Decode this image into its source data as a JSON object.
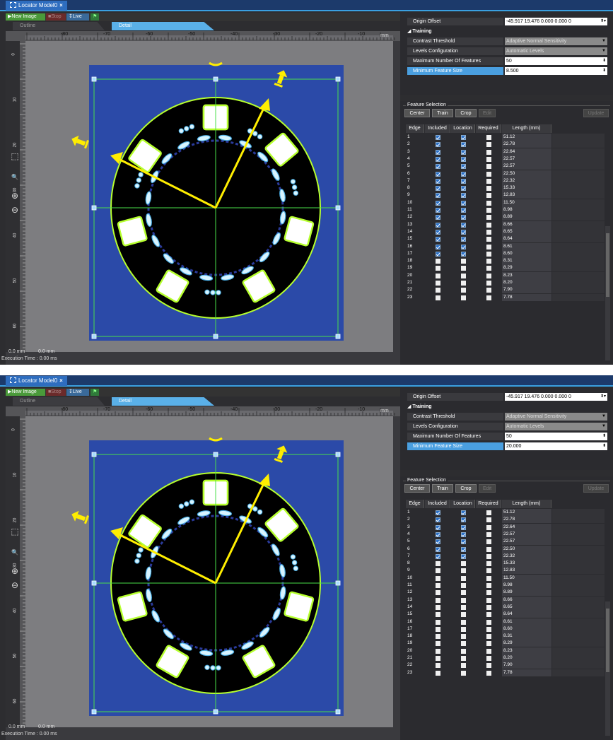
{
  "panels": [
    {
      "tab_title": "Locator Model0",
      "toolbar": {
        "new_image": "New Image",
        "stop": "Stop",
        "live": "Live"
      },
      "view_tabs": {
        "outline": "Outline",
        "detail": "Detail"
      },
      "ruler": {
        "unit": "mm",
        "top_labels": [
          "-80",
          "-70",
          "-60",
          "-50",
          "-40",
          "-30",
          "-20",
          "-10"
        ],
        "left_labels": [
          "0",
          "10",
          "20",
          "30",
          "40",
          "50",
          "60"
        ]
      },
      "status": {
        "x": "0.0 mm",
        "y": "0.0 mm",
        "execution": "Execution Time : 0.00 ms"
      },
      "properties": {
        "origin_offset": {
          "label": "Origin Offset",
          "value": "-45.917 19.476 0.000 0.000 0"
        },
        "training_header": "Training",
        "contrast_threshold": {
          "label": "Contrast Threshold",
          "value": "Adaptive Normal Sensitivity"
        },
        "levels_configuration": {
          "label": "Levels Configuration",
          "value": "Automatic Levels"
        },
        "max_features": {
          "label": "Maximum Number Of Features",
          "value": "50"
        },
        "min_feature_size": {
          "label": "Minimum Feature Size",
          "value": "8.500"
        }
      },
      "feature_selection": {
        "title": "Feature Selection",
        "buttons": {
          "center": "Center",
          "train": "Train",
          "crop": "Crop",
          "edit": "Edit",
          "update": "Update"
        },
        "headers": [
          "Edge",
          "Included",
          "Location",
          "Required",
          "Length (mm)"
        ],
        "rows": [
          {
            "edge": "1",
            "included": true,
            "location": true,
            "required": false,
            "length": "51.12"
          },
          {
            "edge": "2",
            "included": true,
            "location": true,
            "required": false,
            "length": "22.78"
          },
          {
            "edge": "3",
            "included": true,
            "location": true,
            "required": false,
            "length": "22.64"
          },
          {
            "edge": "4",
            "included": true,
            "location": true,
            "required": false,
            "length": "22.57"
          },
          {
            "edge": "5",
            "included": true,
            "location": true,
            "required": false,
            "length": "22.57"
          },
          {
            "edge": "6",
            "included": true,
            "location": true,
            "required": false,
            "length": "22.50"
          },
          {
            "edge": "7",
            "included": true,
            "location": true,
            "required": false,
            "length": "22.32"
          },
          {
            "edge": "8",
            "included": true,
            "location": true,
            "required": false,
            "length": "15.33"
          },
          {
            "edge": "9",
            "included": true,
            "location": true,
            "required": false,
            "length": "12.83"
          },
          {
            "edge": "10",
            "included": true,
            "location": true,
            "required": false,
            "length": "11.50"
          },
          {
            "edge": "11",
            "included": true,
            "location": true,
            "required": false,
            "length": "8.98"
          },
          {
            "edge": "12",
            "included": true,
            "location": true,
            "required": false,
            "length": "8.89"
          },
          {
            "edge": "13",
            "included": true,
            "location": true,
            "required": false,
            "length": "8.66"
          },
          {
            "edge": "14",
            "included": true,
            "location": true,
            "required": false,
            "length": "8.65"
          },
          {
            "edge": "15",
            "included": true,
            "location": true,
            "required": false,
            "length": "8.64"
          },
          {
            "edge": "16",
            "included": true,
            "location": true,
            "required": false,
            "length": "8.61"
          },
          {
            "edge": "17",
            "included": true,
            "location": true,
            "required": false,
            "length": "8.60"
          },
          {
            "edge": "18",
            "included": false,
            "location": false,
            "required": false,
            "length": "8.31"
          },
          {
            "edge": "19",
            "included": false,
            "location": false,
            "required": false,
            "length": "8.29"
          },
          {
            "edge": "20",
            "included": false,
            "location": false,
            "required": false,
            "length": "8.23"
          },
          {
            "edge": "21",
            "included": false,
            "location": false,
            "required": false,
            "length": "8.20"
          },
          {
            "edge": "22",
            "included": false,
            "location": false,
            "required": false,
            "length": "7.90"
          },
          {
            "edge": "23",
            "included": false,
            "location": false,
            "required": false,
            "length": "7.78"
          }
        ]
      }
    },
    {
      "tab_title": "Locator Model0",
      "toolbar": {
        "new_image": "New Image",
        "stop": "Stop",
        "live": "Live"
      },
      "view_tabs": {
        "outline": "Outline",
        "detail": "Detail"
      },
      "ruler": {
        "unit": "mm",
        "top_labels": [
          "-80",
          "-70",
          "-60",
          "-50",
          "-40",
          "-30",
          "-20",
          "-10"
        ],
        "left_labels": [
          "0",
          "10",
          "20",
          "30",
          "40",
          "50",
          "60"
        ]
      },
      "status": {
        "x": "0.0 mm",
        "y": "0.0 mm",
        "execution": "Execution Time : 0.00 ms"
      },
      "properties": {
        "origin_offset": {
          "label": "Origin Offset",
          "value": "-45.917 19.476 0.000 0.000 0"
        },
        "training_header": "Training",
        "contrast_threshold": {
          "label": "Contrast Threshold",
          "value": "Adaptive Normal Sensitivity"
        },
        "levels_configuration": {
          "label": "Levels Configuration",
          "value": "Automatic Levels"
        },
        "max_features": {
          "label": "Maximum Number Of Features",
          "value": "50"
        },
        "min_feature_size": {
          "label": "Minimum Feature Size",
          "value": "20.000"
        }
      },
      "feature_selection": {
        "title": "Feature Selection",
        "buttons": {
          "center": "Center",
          "train": "Train",
          "crop": "Crop",
          "edit": "Edit",
          "update": "Update"
        },
        "headers": [
          "Edge",
          "Included",
          "Location",
          "Required",
          "Length (mm)"
        ],
        "rows": [
          {
            "edge": "1",
            "included": true,
            "location": true,
            "required": false,
            "length": "51.12"
          },
          {
            "edge": "2",
            "included": true,
            "location": true,
            "required": false,
            "length": "22.78"
          },
          {
            "edge": "3",
            "included": true,
            "location": true,
            "required": false,
            "length": "22.64"
          },
          {
            "edge": "4",
            "included": true,
            "location": true,
            "required": false,
            "length": "22.57"
          },
          {
            "edge": "5",
            "included": true,
            "location": true,
            "required": false,
            "length": "22.57"
          },
          {
            "edge": "6",
            "included": true,
            "location": true,
            "required": false,
            "length": "22.50"
          },
          {
            "edge": "7",
            "included": true,
            "location": true,
            "required": false,
            "length": "22.32"
          },
          {
            "edge": "8",
            "included": false,
            "location": false,
            "required": false,
            "length": "15.33"
          },
          {
            "edge": "9",
            "included": false,
            "location": false,
            "required": false,
            "length": "12.83"
          },
          {
            "edge": "10",
            "included": false,
            "location": false,
            "required": false,
            "length": "11.50"
          },
          {
            "edge": "11",
            "included": false,
            "location": false,
            "required": false,
            "length": "8.98"
          },
          {
            "edge": "12",
            "included": false,
            "location": false,
            "required": false,
            "length": "8.89"
          },
          {
            "edge": "13",
            "included": false,
            "location": false,
            "required": false,
            "length": "8.66"
          },
          {
            "edge": "14",
            "included": false,
            "location": false,
            "required": false,
            "length": "8.65"
          },
          {
            "edge": "15",
            "included": false,
            "location": false,
            "required": false,
            "length": "8.64"
          },
          {
            "edge": "16",
            "included": false,
            "location": false,
            "required": false,
            "length": "8.61"
          },
          {
            "edge": "17",
            "included": false,
            "location": false,
            "required": false,
            "length": "8.60"
          },
          {
            "edge": "18",
            "included": false,
            "location": false,
            "required": false,
            "length": "8.31"
          },
          {
            "edge": "19",
            "included": false,
            "location": false,
            "required": false,
            "length": "8.29"
          },
          {
            "edge": "20",
            "included": false,
            "location": false,
            "required": false,
            "length": "8.23"
          },
          {
            "edge": "21",
            "included": false,
            "location": false,
            "required": false,
            "length": "8.20"
          },
          {
            "edge": "22",
            "included": false,
            "location": false,
            "required": false,
            "length": "7.90"
          },
          {
            "edge": "23",
            "included": false,
            "location": false,
            "required": false,
            "length": "7.78"
          }
        ]
      }
    }
  ],
  "icons": [
    "fit-to-window-icon",
    "zoom-100-icon",
    "zoom-in-icon",
    "zoom-out-icon",
    "close-icon",
    "play-icon",
    "stop-icon",
    "live-icon",
    "flag-icon"
  ],
  "colors": {
    "image_background": "#2b4aa8",
    "part": "#000000",
    "feature_outline": "#b6ff2e",
    "axis_arrow": "#ffee00",
    "guide_lines": "#4adf4a",
    "handles": "#a8dcff",
    "highlight": "#4a9fe0"
  }
}
